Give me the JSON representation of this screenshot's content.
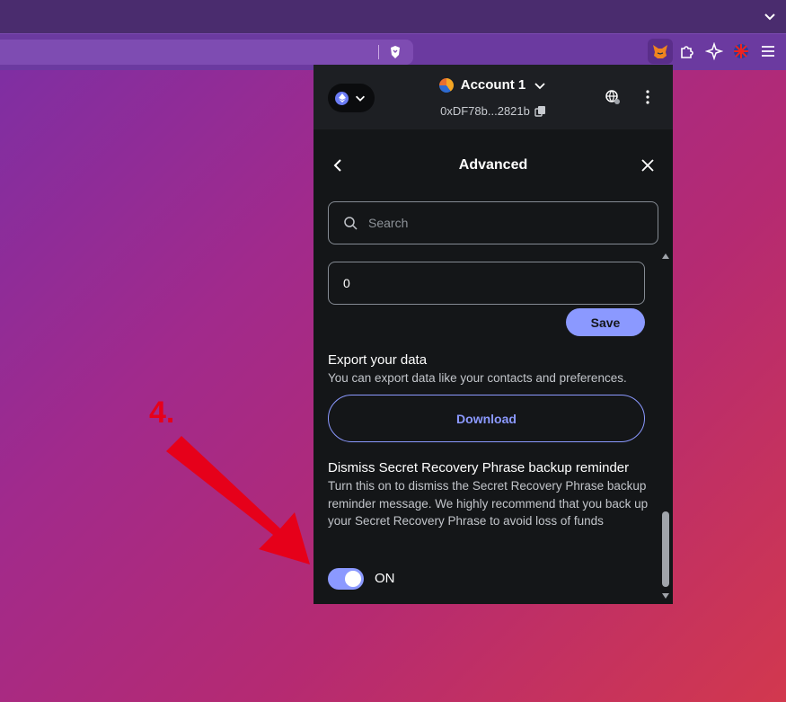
{
  "browser": {
    "extension_icons": [
      "metamask-fox-icon",
      "puzzle-icon",
      "sparkle-icon",
      "profile-flag-icon",
      "menu-icon"
    ]
  },
  "wallet": {
    "account_name": "Account 1",
    "address": "0xDF78b...2821b",
    "network_icon": "ethereum-icon"
  },
  "page": {
    "title": "Advanced",
    "search_placeholder": "Search",
    "number_field_value": "0",
    "save_label": "Save",
    "export_heading": "Export your data",
    "export_description": "You can export data like your contacts and preferences.",
    "download_label": "Download",
    "dismiss_heading": "Dismiss Secret Recovery Phrase backup reminder",
    "dismiss_description": "Turn this on to dismiss the Secret Recovery Phrase backup reminder message. We highly recommend that you back up your Secret Recovery Phrase to avoid loss of funds",
    "toggle_state": "ON"
  },
  "annotation": {
    "step_label": "4."
  },
  "colors": {
    "accent": "#8b99ff",
    "popup_bg": "#141618",
    "annotation_red": "#e6001a"
  }
}
